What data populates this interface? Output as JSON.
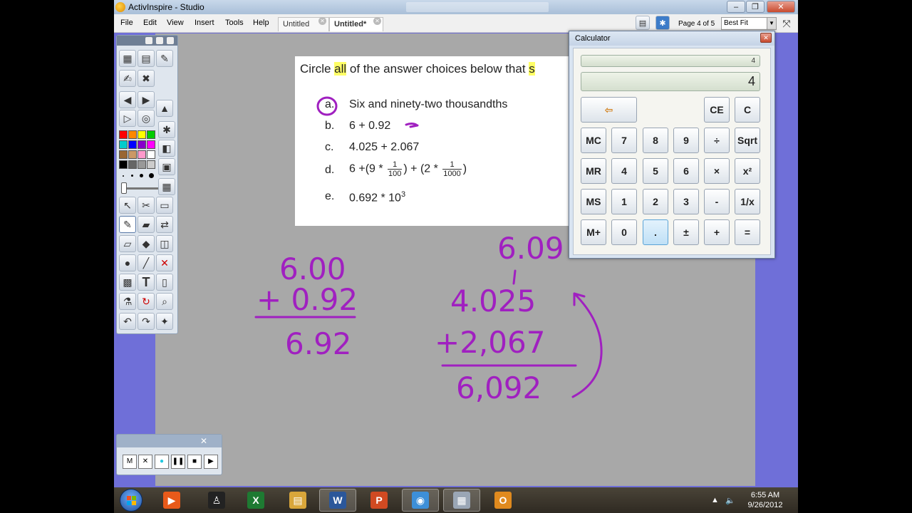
{
  "window": {
    "title": "ActivInspire - Studio",
    "controls": [
      "–",
      "❐",
      "✕"
    ]
  },
  "menu": [
    "File",
    "Edit",
    "View",
    "Insert",
    "Tools",
    "Help"
  ],
  "tabs": [
    {
      "label": "Untitled",
      "active": false
    },
    {
      "label": "Untitled*",
      "active": true
    }
  ],
  "pager": {
    "page_label": "Page 4 of 5",
    "zoom": "Best Fit"
  },
  "flipchart": {
    "question_pre": "Circle ",
    "question_highlight": "all",
    "question_post": " of the answer choices below that ",
    "question_cut": "s",
    "choices": [
      {
        "label": "a.",
        "text": "Six and ninety-two thousandths"
      },
      {
        "label": "b.",
        "text": "6 + 0.92"
      },
      {
        "label": "c.",
        "text": "4.025 + 2.067"
      },
      {
        "label": "d.",
        "text_pre": "6 +(9 * ",
        "frac1_num": "1",
        "frac1_den": "100",
        "text_mid": ") + (2 * ",
        "frac2_num": "1",
        "frac2_den": "1000",
        "text_post": ")"
      },
      {
        "label": "e.",
        "text": "0.692 * 10",
        "sup": "3"
      }
    ]
  },
  "ink": {
    "color": "#a020c0",
    "work1": {
      "line1": "6.00",
      "line2": "+ 0.92",
      "result": "6.92"
    },
    "work2": {
      "top": "6.09",
      "line1": "4.025",
      "line2": "+2,067",
      "result": "6,092"
    }
  },
  "toolbox": {
    "palette": [
      "#ff0000",
      "#ff8800",
      "#ffff00",
      "#00cc00",
      "#00cccc",
      "#0000ff",
      "#8800cc",
      "#ff00ff",
      "#996633",
      "#cc9966",
      "#ff99cc",
      "#ffffff",
      "#000000",
      "#666666",
      "#999999",
      "#cccccc"
    ]
  },
  "recorder": {
    "buttons": [
      "M",
      "✕",
      "●",
      "❚❚",
      "■",
      "▶"
    ],
    "close": "✕"
  },
  "calculator": {
    "title": "Calculator",
    "memory_display": "4",
    "display": "4",
    "backspace": "⇦",
    "rows": [
      [
        "MC",
        "7",
        "8",
        "9",
        "÷",
        "Sqrt"
      ],
      [
        "MR",
        "4",
        "5",
        "6",
        "×",
        "x²"
      ],
      [
        "MS",
        "1",
        "2",
        "3",
        "-",
        "1/x"
      ],
      [
        "M+",
        "0",
        ".",
        "±",
        "+",
        "="
      ]
    ],
    "top_right": [
      "CE",
      "C"
    ]
  },
  "taskbar": {
    "time": "6:55 AM",
    "date": "9/26/2012",
    "apps": [
      {
        "name": "media",
        "glyph": "▶",
        "color": "#e85a1a"
      },
      {
        "name": "activinspire",
        "glyph": "♙",
        "color": "#222222"
      },
      {
        "name": "excel",
        "glyph": "X",
        "color": "#1e7a32"
      },
      {
        "name": "explorer",
        "glyph": "▤",
        "color": "#d9a63a"
      },
      {
        "name": "word",
        "glyph": "W",
        "color": "#2b579a"
      },
      {
        "name": "powerpoint",
        "glyph": "P",
        "color": "#d04a22"
      },
      {
        "name": "chrome",
        "glyph": "◉",
        "color": "#3d8fd8"
      },
      {
        "name": "calculator",
        "glyph": "▦",
        "color": "#9aa6b5"
      },
      {
        "name": "outlook",
        "glyph": "O",
        "color": "#e08a1e"
      }
    ]
  }
}
